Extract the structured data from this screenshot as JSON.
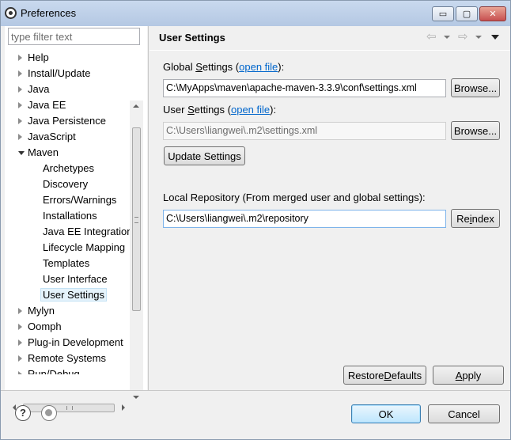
{
  "window": {
    "title": "Preferences",
    "minimize_glyph": "▭",
    "maximize_glyph": "▢",
    "close_glyph": "✕"
  },
  "filter": {
    "placeholder": "type filter text",
    "value": ""
  },
  "tree": {
    "items": [
      {
        "label": "Help",
        "state": "collapsed",
        "level": 0
      },
      {
        "label": "Install/Update",
        "state": "collapsed",
        "level": 0
      },
      {
        "label": "Java",
        "state": "collapsed",
        "level": 0
      },
      {
        "label": "Java EE",
        "state": "collapsed",
        "level": 0
      },
      {
        "label": "Java Persistence",
        "state": "collapsed",
        "level": 0
      },
      {
        "label": "JavaScript",
        "state": "collapsed",
        "level": 0
      },
      {
        "label": "Maven",
        "state": "expanded",
        "level": 0
      },
      {
        "label": "Archetypes",
        "state": "leaf",
        "level": 1
      },
      {
        "label": "Discovery",
        "state": "leaf",
        "level": 1
      },
      {
        "label": "Errors/Warnings",
        "state": "leaf",
        "level": 1
      },
      {
        "label": "Installations",
        "state": "leaf",
        "level": 1
      },
      {
        "label": "Java EE Integration",
        "state": "leaf",
        "level": 1
      },
      {
        "label": "Lifecycle Mapping",
        "state": "leaf",
        "level": 1
      },
      {
        "label": "Templates",
        "state": "leaf",
        "level": 1
      },
      {
        "label": "User Interface",
        "state": "leaf",
        "level": 1
      },
      {
        "label": "User Settings",
        "state": "leaf",
        "level": 1,
        "selected": true
      },
      {
        "label": "Mylyn",
        "state": "collapsed",
        "level": 0
      },
      {
        "label": "Oomph",
        "state": "collapsed",
        "level": 0
      },
      {
        "label": "Plug-in Development",
        "state": "collapsed",
        "level": 0
      },
      {
        "label": "Remote Systems",
        "state": "collapsed",
        "level": 0
      },
      {
        "label": "Run/Debug",
        "state": "collapsed",
        "level": 0
      }
    ]
  },
  "page": {
    "title": "User Settings",
    "nav": {
      "back_glyph": "⇦",
      "forward_glyph": "⇨"
    },
    "global_settings": {
      "label_prefix": "Global ",
      "label_accel": "S",
      "label_rest": "ettings (",
      "link": "open file",
      "label_suffix": "):",
      "value": "C:\\MyApps\\maven\\apache-maven-3.3.9\\conf\\settings.xml",
      "browse": "Browse..."
    },
    "user_settings": {
      "label_prefix": "User ",
      "label_accel": "S",
      "label_rest": "ettings (",
      "link": "open file",
      "label_suffix": "):",
      "value": "C:\\Users\\liangwei\\.m2\\settings.xml",
      "browse": "Browse..."
    },
    "update_button": "Update Settings",
    "local_repo": {
      "label": "Local Repository (From merged user and global settings):",
      "value": "C:\\Users\\liangwei\\.m2\\repository",
      "reindex_prefix": "Re",
      "reindex_accel": "i",
      "reindex_suffix": "ndex"
    },
    "restore_defaults": {
      "prefix": "Restore ",
      "accel": "D",
      "suffix": "efaults"
    },
    "apply": {
      "prefix": "",
      "accel": "A",
      "suffix": "pply"
    }
  },
  "footer": {
    "help_glyph": "?",
    "ok": "OK",
    "cancel": "Cancel"
  }
}
